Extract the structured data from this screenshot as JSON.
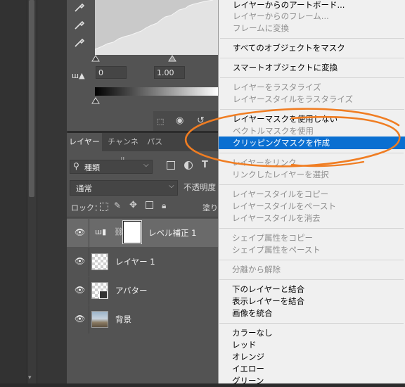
{
  "properties": {
    "input_black": "0",
    "input_gamma": "1.00"
  },
  "layers_panel": {
    "tabs": [
      "レイヤー",
      "チャンネル",
      "パス"
    ],
    "filter_kind": "種類",
    "blend_mode": "通常",
    "opacity_label": "不透明度",
    "lock_label": "ロック：",
    "fill_label": "塗り",
    "layers": [
      {
        "name": "レベル補正 1",
        "type": "adjustment"
      },
      {
        "name": "レイヤー 1",
        "type": "pixel"
      },
      {
        "name": "アバター",
        "type": "smart"
      },
      {
        "name": "背景",
        "type": "image"
      }
    ]
  },
  "context_menu": {
    "items": [
      {
        "label": "レイヤーからのアートボード...",
        "enabled": true
      },
      {
        "label": "レイヤーからのフレーム...",
        "enabled": false
      },
      {
        "label": "フレームに変換",
        "enabled": false
      },
      {
        "label": "すべてのオブジェクトをマスク",
        "enabled": true
      },
      {
        "label": "スマートオブジェクトに変換",
        "enabled": true
      },
      {
        "label": "レイヤーをラスタライズ",
        "enabled": false
      },
      {
        "label": "レイヤースタイルをラスタライズ",
        "enabled": false
      },
      {
        "label": "レイヤーマスクを使用しない",
        "enabled": true
      },
      {
        "label": "ベクトルマスクを使用",
        "enabled": false
      },
      {
        "label": "クリッピングマスクを作成",
        "enabled": true,
        "highlighted": true
      },
      {
        "label": "レイヤーをリンク",
        "enabled": false
      },
      {
        "label": "リンクしたレイヤーを選択",
        "enabled": false
      },
      {
        "label": "レイヤースタイルをコピー",
        "enabled": false
      },
      {
        "label": "レイヤースタイルをペースト",
        "enabled": false
      },
      {
        "label": "レイヤースタイルを消去",
        "enabled": false
      },
      {
        "label": "シェイプ属性をコピー",
        "enabled": false
      },
      {
        "label": "シェイプ属性をペースト",
        "enabled": false
      },
      {
        "label": "分離から解除",
        "enabled": false
      },
      {
        "label": "下のレイヤーと結合",
        "enabled": true
      },
      {
        "label": "表示レイヤーを結合",
        "enabled": true
      },
      {
        "label": "画像を統合",
        "enabled": true
      },
      {
        "label": "カラーなし",
        "enabled": true
      },
      {
        "label": "レッド",
        "enabled": true
      },
      {
        "label": "オレンジ",
        "enabled": true
      },
      {
        "label": "イエロー",
        "enabled": true
      },
      {
        "label": "グリーン",
        "enabled": true
      }
    ]
  },
  "colors": {
    "menu_highlight": "#0a6fd1",
    "annotation": "#f07d22"
  }
}
